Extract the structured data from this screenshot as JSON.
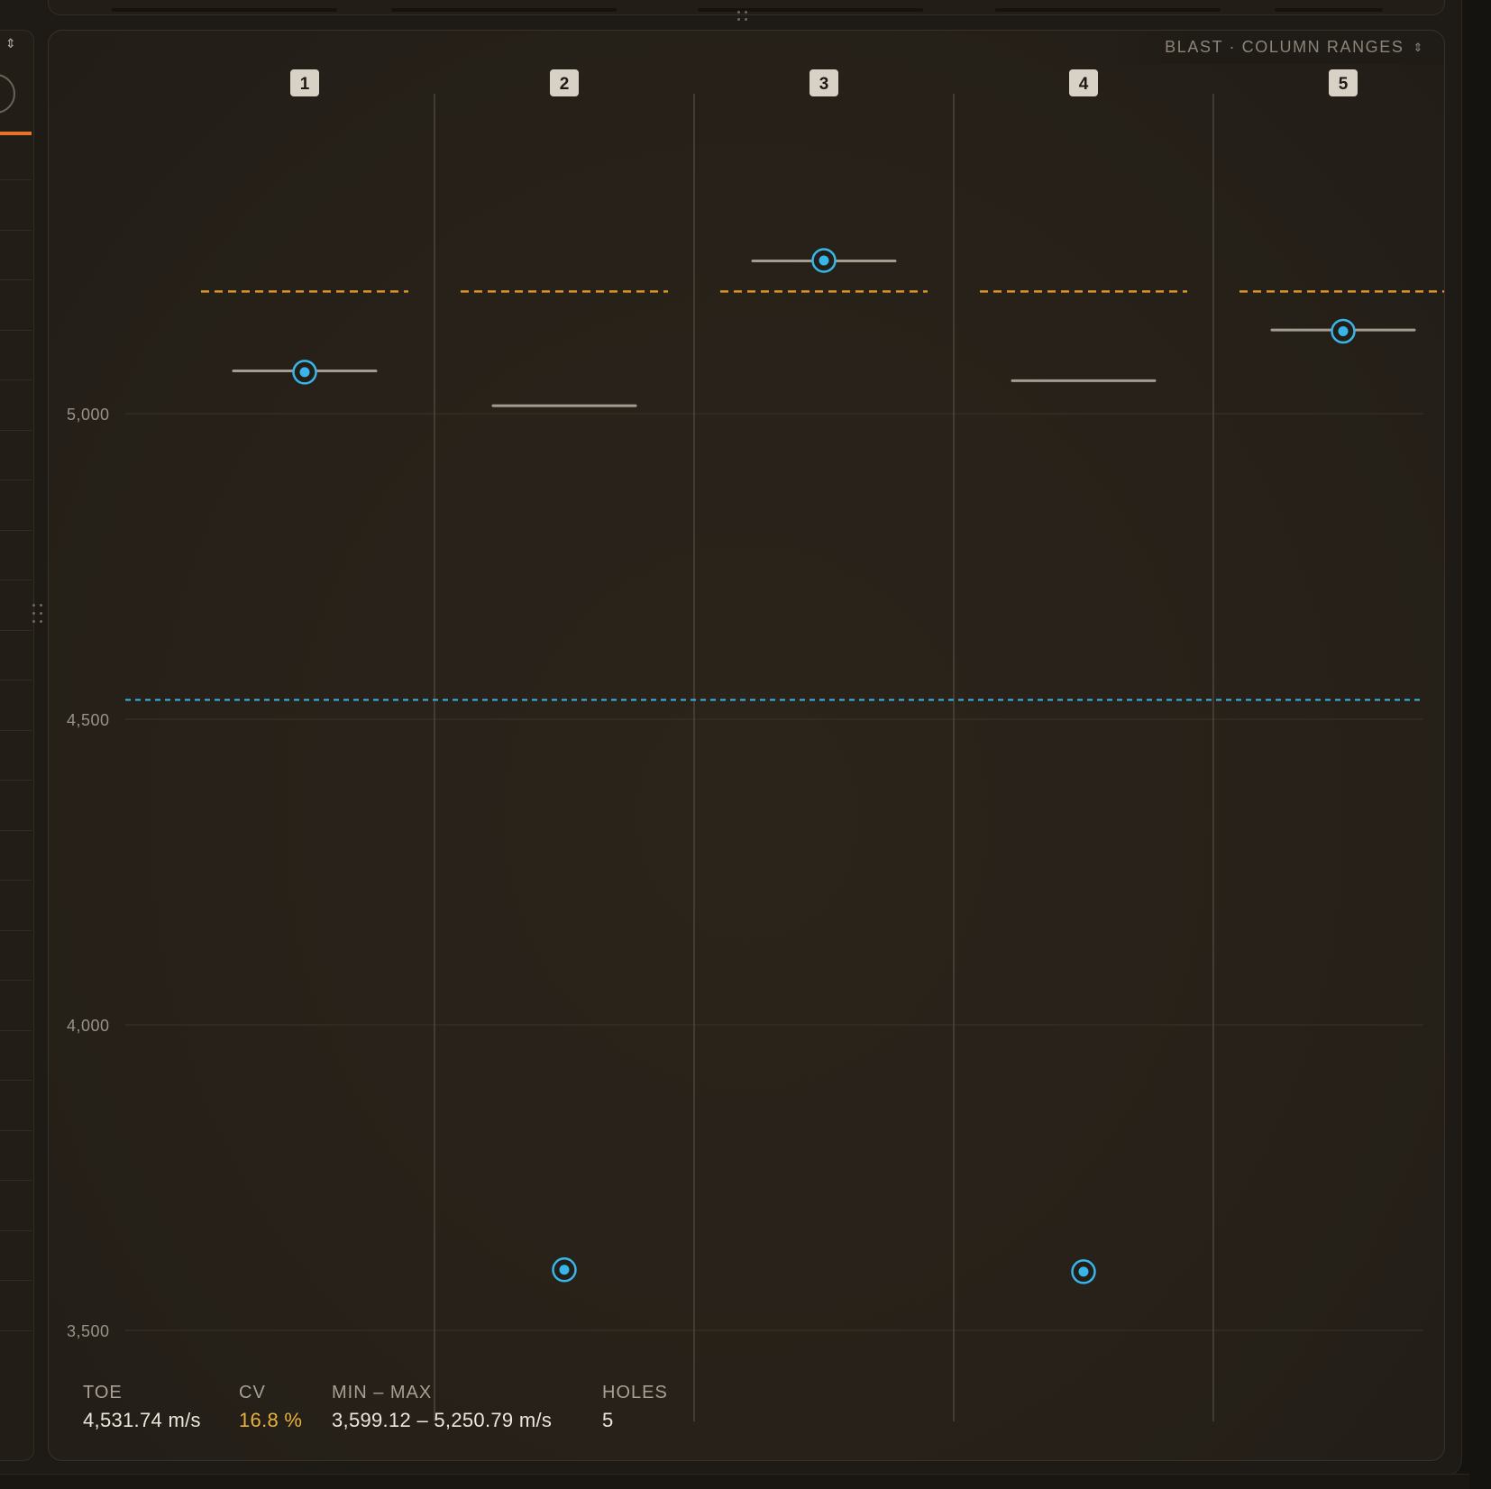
{
  "panel": {
    "title": "BLAST · COLUMN RANGES",
    "title_chevron": "⌃⌄"
  },
  "stats": {
    "toe": {
      "label": "TOE",
      "value": "4,531.74 m/s"
    },
    "cv": {
      "label": "CV",
      "value": "16.8 %"
    },
    "min_max": {
      "label": "MIN – MAX",
      "value": "3,599.12 – 5,250.79 m/s"
    },
    "holes": {
      "label": "HOLES",
      "value": "5"
    }
  },
  "colors": {
    "accent_blue": "#38b6ea",
    "threshold_orange": "#d8962a",
    "range_line": "#a39c90",
    "column_badge": "#d8d2c6",
    "warning_text": "#e8b13c"
  },
  "chart_data": {
    "type": "scatter",
    "title": "BLAST · COLUMN RANGES",
    "categories": [
      "1",
      "2",
      "3",
      "4",
      "5"
    ],
    "y_ticks": [
      "5,000",
      "4,500",
      "4,000",
      "3,500"
    ],
    "ylim": [
      3500,
      5000
    ],
    "grid": true,
    "reference_line": {
      "name": "TOE",
      "value": 4531.74,
      "color": "#38b6ea",
      "style": "dashed"
    },
    "thresholds": [
      5200,
      5200,
      5200,
      5200,
      5200
    ],
    "range_lines": [
      5070,
      5013,
      5250,
      5054,
      5137
    ],
    "points": [
      {
        "column": "1",
        "value": 5068
      },
      {
        "column": "2",
        "value": 3599.12
      },
      {
        "column": "3",
        "value": 5250.79
      },
      {
        "column": "4",
        "value": 3596
      },
      {
        "column": "5",
        "value": 5135
      }
    ]
  }
}
